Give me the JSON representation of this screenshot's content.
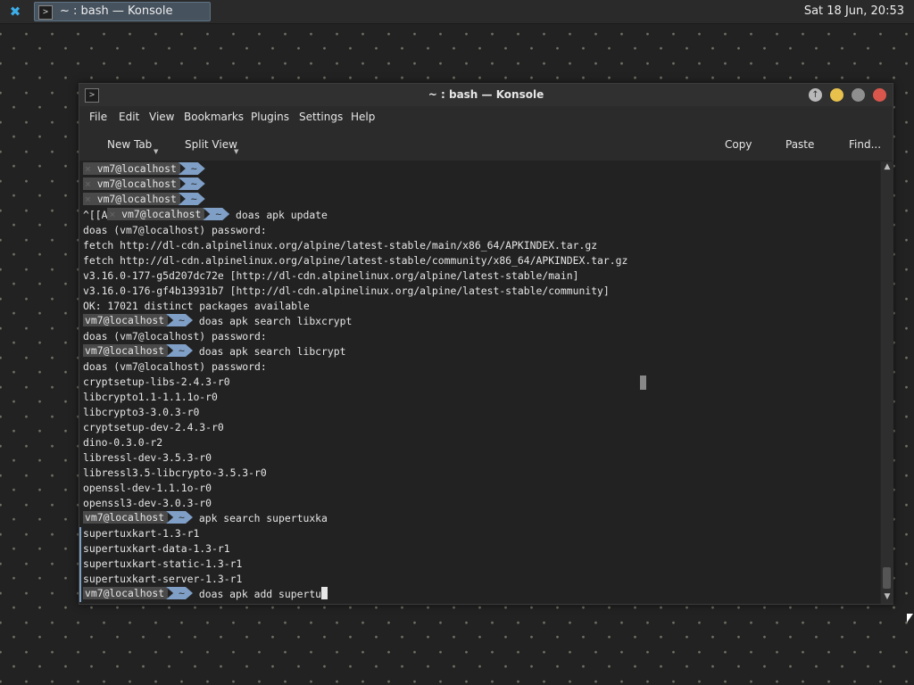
{
  "panel": {
    "launcher_icon": "launcher-icon",
    "task_icon": "terminal-icon",
    "task_label": "~ : bash — Konsole",
    "clock": "Sat 18 Jun, 20:53"
  },
  "window": {
    "title": "~ : bash — Konsole",
    "icon": "terminal-icon",
    "buttons": [
      "keep-above",
      "minimize",
      "maximize",
      "close"
    ]
  },
  "menu": [
    "File",
    "Edit",
    "View",
    "Bookmarks",
    "Plugins",
    "Settings",
    "Help"
  ],
  "toolbar": {
    "new_tab": "New Tab",
    "split_view": "Split View",
    "copy": "Copy",
    "paste": "Paste",
    "find": "Find..."
  },
  "prompt": {
    "user_host": "vm7@localhost",
    "dir": "~",
    "error_mark": "×"
  },
  "terminal": {
    "l0": "",
    "l1": "",
    "l2": "",
    "l3_prefix": "^[[A",
    "l3_cmd": "doas apk update",
    "l4": "doas (vm7@localhost) password:",
    "l5": "fetch http://dl-cdn.alpinelinux.org/alpine/latest-stable/main/x86_64/APKINDEX.tar.gz",
    "l6": "fetch http://dl-cdn.alpinelinux.org/alpine/latest-stable/community/x86_64/APKINDEX.tar.gz",
    "l7": "v3.16.0-177-g5d207dc72e [http://dl-cdn.alpinelinux.org/alpine/latest-stable/main]",
    "l8": "v3.16.0-176-gf4b13931b7 [http://dl-cdn.alpinelinux.org/alpine/latest-stable/community]",
    "l9": "OK: 17021 distinct packages available",
    "l10_cmd": "doas apk search libxcrypt",
    "l11": "doas (vm7@localhost) password:",
    "l12_cmd": "doas apk search libcrypt",
    "l13": "doas (vm7@localhost) password:",
    "l14": "cryptsetup-libs-2.4.3-r0",
    "l15": "libcrypto1.1-1.1.1o-r0",
    "l16": "libcrypto3-3.0.3-r0",
    "l17": "cryptsetup-dev-2.4.3-r0",
    "l18": "dino-0.3.0-r2",
    "l19": "libressl-dev-3.5.3-r0",
    "l20": "libressl3.5-libcrypto-3.5.3-r0",
    "l21": "openssl-dev-1.1.1o-r0",
    "l22": "openssl3-dev-3.0.3-r0",
    "l23_cmd": "apk search supertuxka",
    "l24": "supertuxkart-1.3-r1",
    "l25": "supertuxkart-data-1.3-r1",
    "l26": "supertuxkart-static-1.3-r1",
    "l27": "supertuxkart-server-1.3-r1",
    "l28_cmd": "doas apk add supertu"
  }
}
